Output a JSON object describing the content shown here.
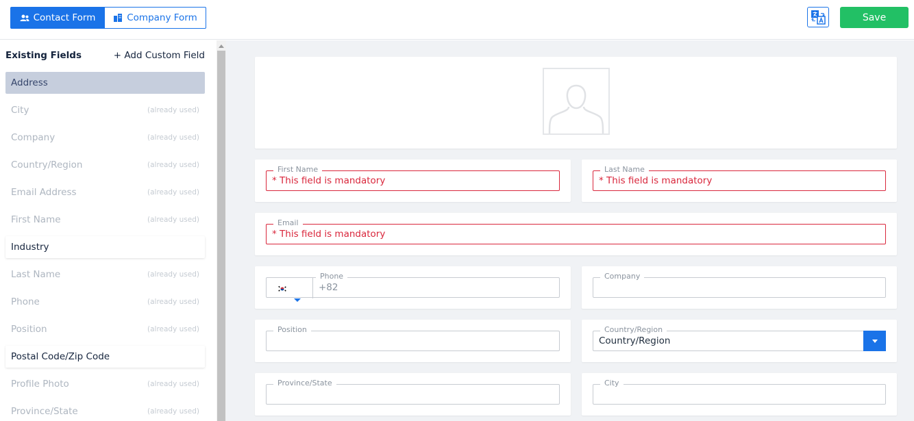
{
  "toolbar": {
    "tab_contact": "Contact Form",
    "tab_company": "Company Form",
    "save_label": "Save"
  },
  "sidebar": {
    "title": "Existing Fields",
    "add_custom": "+ Add Custom Field",
    "used_label": "(already used)",
    "items": [
      {
        "label": "Address",
        "state": "selected"
      },
      {
        "label": "City",
        "state": "used"
      },
      {
        "label": "Company",
        "state": "used"
      },
      {
        "label": "Country/Region",
        "state": "used"
      },
      {
        "label": "Email Address",
        "state": "used"
      },
      {
        "label": "First Name",
        "state": "used"
      },
      {
        "label": "Industry",
        "state": "available"
      },
      {
        "label": "Last Name",
        "state": "used"
      },
      {
        "label": "Phone",
        "state": "used"
      },
      {
        "label": "Position",
        "state": "used"
      },
      {
        "label": "Postal Code/Zip Code",
        "state": "available"
      },
      {
        "label": "Profile Photo",
        "state": "used"
      },
      {
        "label": "Province/State",
        "state": "used"
      }
    ]
  },
  "form": {
    "mandatory_msg": "* This field is mandatory",
    "first_name_label": "First Name",
    "last_name_label": "Last Name",
    "email_label": "Email",
    "phone_label": "Phone",
    "phone_value": "+82",
    "company_label": "Company",
    "position_label": "Position",
    "country_label": "Country/Region",
    "country_value": "Country/Region",
    "province_label": "Province/State",
    "city_label": "City"
  },
  "colors": {
    "primary": "#1a73e8",
    "save": "#22c065",
    "error": "#d9263b"
  }
}
